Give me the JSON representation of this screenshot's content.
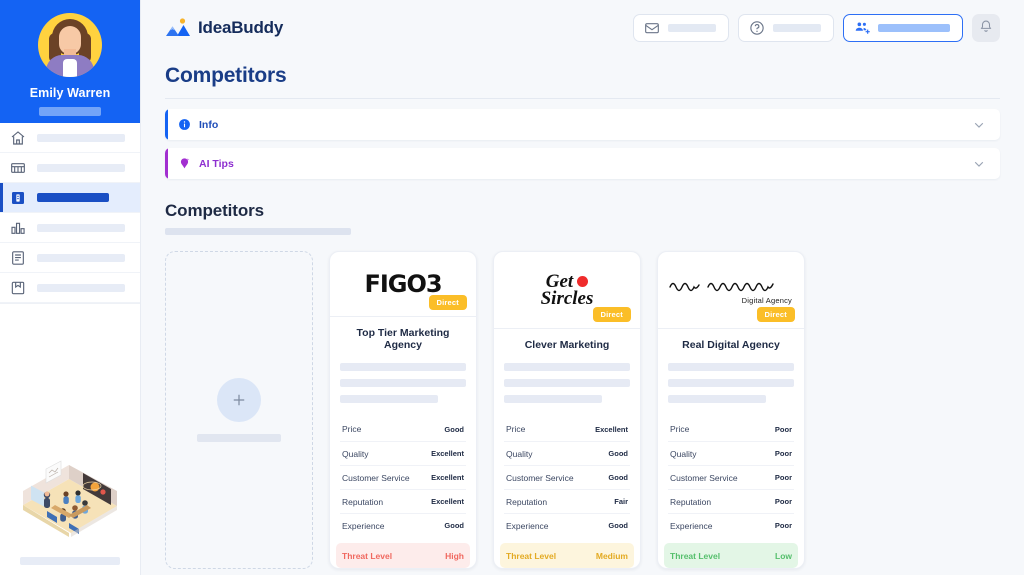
{
  "sidebar": {
    "profile": {
      "name": "Emily Warren",
      "avatar_icon": "user-avatar-illustration"
    },
    "items": [
      {
        "icon": "home-icon",
        "label": "",
        "active": false
      },
      {
        "icon": "grid-board-icon",
        "label": "",
        "active": false
      },
      {
        "icon": "book-idea-icon",
        "label": "",
        "active": true
      },
      {
        "icon": "bar-chart-icon",
        "label": "",
        "active": false
      },
      {
        "icon": "notes-list-icon",
        "label": "",
        "active": false
      },
      {
        "icon": "save-book-icon",
        "label": "",
        "active": false
      }
    ],
    "illustration": "isometric-classroom-illustration"
  },
  "topbar": {
    "brand": {
      "name": "IdeaBuddy",
      "mark_icon": "mountain-sun-logo-icon"
    },
    "actions": [
      {
        "name": "mail-button",
        "icon": "envelope-icon",
        "highlight": false
      },
      {
        "name": "help-button",
        "icon": "question-circle-icon",
        "highlight": false
      },
      {
        "name": "invite-button",
        "icon": "add-person-icon",
        "highlight": true
      }
    ],
    "bell": {
      "icon": "bell-icon"
    }
  },
  "page": {
    "title": "Competitors",
    "panels": [
      {
        "label": "Info",
        "icon": "info-circle-icon",
        "accent": "#1463f3",
        "chevron": "chevron-down-icon"
      },
      {
        "label": "AI Tips",
        "icon": "ai-bulb-icon",
        "accent": "#a22fd0",
        "chevron": "chevron-down-icon"
      }
    ],
    "section_title": "Competitors",
    "add_card": {
      "icon": "plus-icon",
      "label": ""
    },
    "metric_labels": [
      "Price",
      "Quality",
      "Customer Service",
      "Reputation",
      "Experience"
    ],
    "threat_label": "Threat Level",
    "cards": [
      {
        "logo_type": "figo",
        "logo_text": "FIGO3",
        "badge": "Direct",
        "name": "Top Tier Marketing Agency",
        "metrics": [
          "Good",
          "Excellent",
          "Excellent",
          "Excellent",
          "Good"
        ],
        "threat_value": "High",
        "threat_class": "high"
      },
      {
        "logo_type": "get-sircles",
        "logo_line1": "Get",
        "logo_line2": "Sircles",
        "badge": "Direct",
        "name": "Clever Marketing",
        "metrics": [
          "Excellent",
          "Good",
          "Good",
          "Fair",
          "Good"
        ],
        "threat_value": "Medium",
        "threat_class": "medium"
      },
      {
        "logo_type": "squiggle",
        "logo_caption": "Digital Agency",
        "badge": "Direct",
        "name": "Real Digital Agency",
        "metrics": [
          "Poor",
          "Poor",
          "Poor",
          "Poor",
          "Poor"
        ],
        "threat_value": "Low",
        "threat_class": "low"
      }
    ]
  },
  "colors": {
    "sidebar_blue": "#1463f3",
    "accent_navy": "#1a3d87",
    "badge_yellow": "#fbbe28",
    "threat_high": "#f0685f",
    "threat_medium": "#e3aa22",
    "threat_low": "#55bf6c"
  }
}
